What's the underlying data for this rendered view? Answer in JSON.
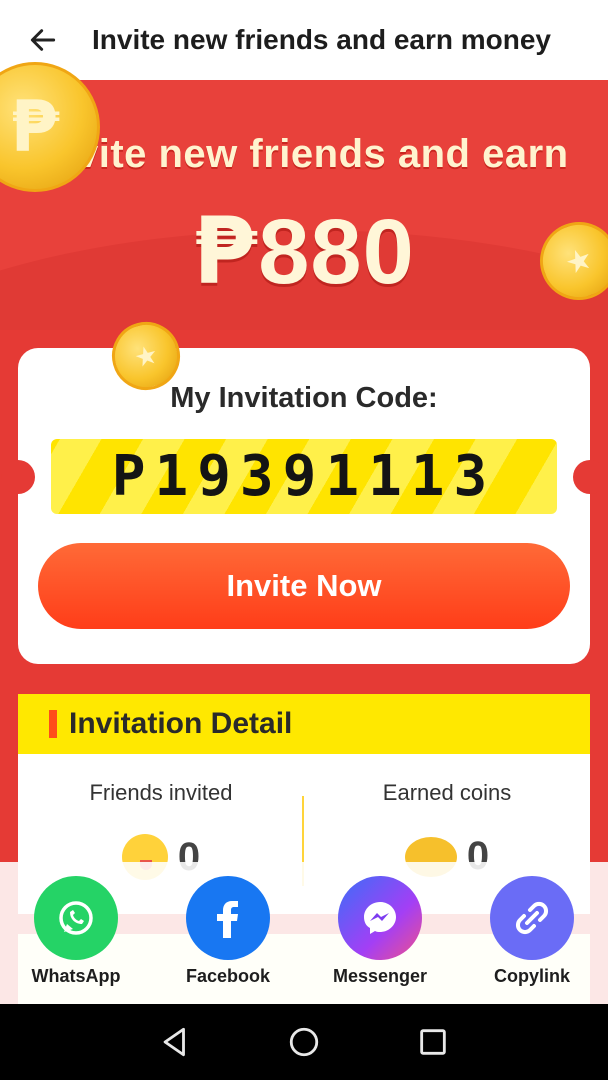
{
  "appbar": {
    "title": "Invite new friends and earn money",
    "back_icon": "arrow-left-icon"
  },
  "hero": {
    "line1": "Invite new friends and earn",
    "currency_symbol": "₱",
    "amount": "880"
  },
  "card": {
    "label": "My Invitation Code:",
    "code": "P19391113",
    "invite_button": "Invite Now"
  },
  "detail": {
    "title": "Invitation Detail",
    "friends_label": "Friends invited",
    "friends_value": "0",
    "coins_label": "Earned coins",
    "coins_value": "0"
  },
  "share": {
    "items": [
      {
        "label": "WhatsApp",
        "icon": "whatsapp-icon",
        "color": "#25d366"
      },
      {
        "label": "Facebook",
        "icon": "facebook-icon",
        "color": "#1877f2"
      },
      {
        "label": "Messenger",
        "icon": "messenger-icon",
        "color": "#8a3ffc"
      },
      {
        "label": "Copylink",
        "icon": "link-icon",
        "color": "#6a6cf6"
      }
    ]
  },
  "system_nav": {
    "back_icon": "nav-back-icon",
    "home_icon": "nav-home-icon",
    "recents_icon": "nav-recents-icon"
  },
  "colors": {
    "brand_red": "#e53a35",
    "code_yellow": "#ffe400",
    "button_orange": "#ff4a1f"
  }
}
